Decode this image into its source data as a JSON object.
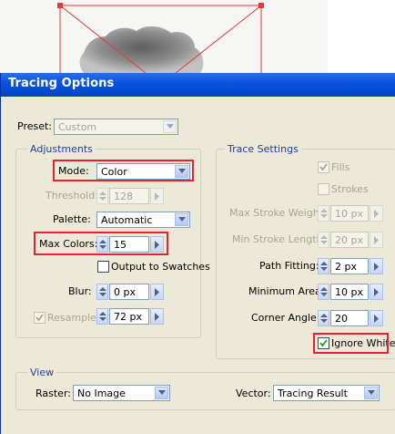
{
  "dialog": {
    "title": "Tracing Options"
  },
  "preset": {
    "label": "Preset:",
    "value": "Custom",
    "disabled": true
  },
  "adjustments": {
    "title": "Adjustments",
    "mode": {
      "label": "Mode:",
      "value": "Color"
    },
    "threshold": {
      "label": "Threshold:",
      "value": "128",
      "disabled": true
    },
    "palette": {
      "label": "Palette:",
      "value": "Automatic"
    },
    "max_colors": {
      "label": "Max Colors:",
      "value": "15"
    },
    "output_to_swatches": {
      "label": "Output to Swatches",
      "checked": false
    },
    "blur": {
      "label": "Blur:",
      "value": "0 px"
    },
    "resample": {
      "label": "Resample:",
      "value": "72 px",
      "checked": true,
      "disabled": true
    }
  },
  "trace_settings": {
    "title": "Trace Settings",
    "fills": {
      "label": "Fills",
      "checked": true,
      "disabled": true
    },
    "strokes": {
      "label": "Strokes",
      "checked": false,
      "disabled": true
    },
    "max_stroke_weight": {
      "label": "Max Stroke Weight:",
      "value": "10 px",
      "disabled": true
    },
    "min_stroke_length": {
      "label": "Min Stroke Length:",
      "value": "20 px",
      "disabled": true
    },
    "path_fitting": {
      "label": "Path Fitting:",
      "value": "2 px"
    },
    "minimum_area": {
      "label": "Minimum Area:",
      "value": "10 px"
    },
    "corner_angle": {
      "label": "Corner Angle:",
      "value": "20"
    },
    "ignore_white": {
      "label": "Ignore White",
      "checked": true
    }
  },
  "view": {
    "title": "View",
    "raster": {
      "label": "Raster:",
      "value": "No Image"
    },
    "vector": {
      "label": "Vector:",
      "value": "Tracing Result"
    }
  },
  "colors": {
    "title_bar": "#0a54e0",
    "dialog_bg": "#ece9d8",
    "group_title": "#1e3fa8",
    "highlight": "#e3232e"
  }
}
